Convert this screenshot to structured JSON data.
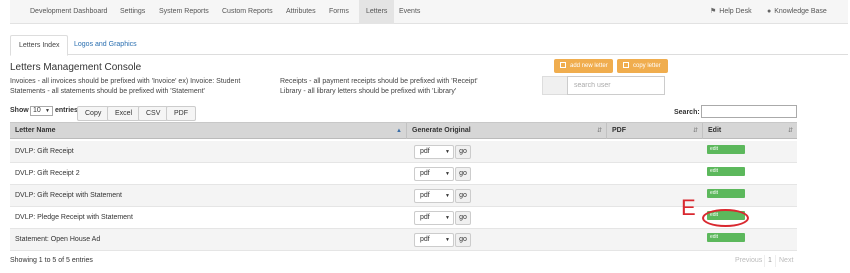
{
  "topnav": {
    "items": [
      {
        "label": "Development Dashboard",
        "icon": ""
      },
      {
        "label": "Settings",
        "icon": ""
      },
      {
        "label": "System Reports",
        "icon": ""
      },
      {
        "label": "Custom Reports",
        "icon": ""
      },
      {
        "label": "Attributes",
        "icon": ""
      },
      {
        "label": "Forms",
        "icon": ""
      },
      {
        "label": "Letters",
        "icon": "",
        "active": true
      },
      {
        "label": "Events",
        "icon": ""
      }
    ],
    "right": [
      {
        "label": "Help Desk",
        "icon": "tag-icon"
      },
      {
        "label": "Knowledge Base",
        "icon": "apple-icon"
      }
    ]
  },
  "tabs": [
    {
      "label": "Letters Index",
      "active": true
    },
    {
      "label": "Logos and Graphics",
      "active": false
    }
  ],
  "console": {
    "title": "Letters Management Console",
    "notes_left": [
      "Invoices - all invoices should be prefixed with 'Invoice' ex) Invoice: Student",
      "Statements - all statements should be prefixed with 'Statement'"
    ],
    "notes_right": [
      "Receipts - all payment receipts should be prefixed with 'Receipt'",
      "Library - all library letters should be prefixed with 'Library'"
    ],
    "add_button": "add new letter",
    "copy_button": "copy letter",
    "search_user_placeholder": "search user"
  },
  "table_controls": {
    "show_label": "Show",
    "entries_value": "10",
    "entries_label": "entries",
    "export_buttons": [
      "Copy",
      "Excel",
      "CSV",
      "PDF"
    ],
    "search_label": "Search:",
    "search_value": ""
  },
  "table": {
    "columns": [
      "Letter Name",
      "Generate Original",
      "PDF",
      "Edit"
    ],
    "rows": [
      {
        "name": "DVLP: Gift Receipt",
        "format": "pdf",
        "go": "go",
        "edit": "edit"
      },
      {
        "name": "DVLP: Gift Receipt 2",
        "format": "pdf",
        "go": "go",
        "edit": "edit"
      },
      {
        "name": "DVLP: Gift Receipt with Statement",
        "format": "pdf",
        "go": "go",
        "edit": "edit"
      },
      {
        "name": "DVLP: Pledge Receipt with Statement",
        "format": "pdf",
        "go": "go",
        "edit": "edit"
      },
      {
        "name": "Statement: Open House Ad",
        "format": "pdf",
        "go": "go",
        "edit": "edit"
      }
    ]
  },
  "footer": {
    "info": "Showing 1 to 5 of 5 entries",
    "pager": [
      "Previous",
      "1",
      "Next"
    ]
  },
  "annotation": {
    "letter": "E",
    "color": "#d9282f"
  },
  "colors": {
    "accent_orange": "#f0ad4e",
    "edit_green": "#5cb85c",
    "link_blue": "#2a6fb0"
  }
}
